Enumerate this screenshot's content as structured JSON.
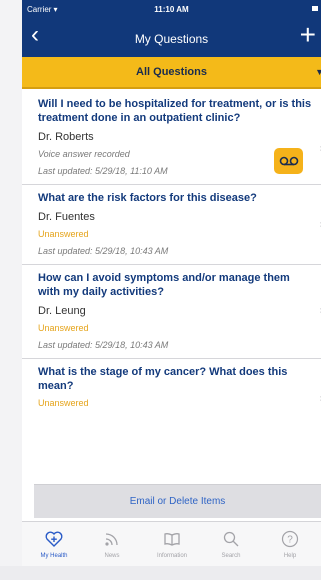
{
  "status_bar": {
    "carrier": "Carrier",
    "time": "11:10 AM"
  },
  "nav": {
    "title": "My Questions",
    "back_icon": "chevron-left-icon",
    "add_icon": "plus-icon"
  },
  "filter": {
    "label": "All Questions"
  },
  "questions": [
    {
      "text": "Will I need to be hospitalized for treatment, or is this treatment done in an outpatient clinic?",
      "doctor": "Dr. Roberts",
      "status": "Voice answer recorded",
      "updated": "Last updated: 5/29/18, 11:10 AM"
    },
    {
      "text": "What are the risk factors for this disease?",
      "doctor": "Dr. Fuentes",
      "status": "Unanswered",
      "updated": "Last updated: 5/29/18, 10:43 AM"
    },
    {
      "text": "How can I avoid symptoms and/or manage them with my daily activities?",
      "doctor": "Dr. Leung",
      "status": "Unanswered",
      "updated": "Last updated: 5/29/18, 10:43 AM"
    },
    {
      "text": "What is the stage of my cancer? What does this mean?",
      "status": "Unanswered"
    }
  ],
  "action_bar": {
    "label": "Email or Delete Items"
  },
  "tabs": [
    {
      "label": "My Health",
      "icon": "heart-plus-icon",
      "active": true
    },
    {
      "label": "News",
      "icon": "rss-icon"
    },
    {
      "label": "Information",
      "icon": "book-icon"
    },
    {
      "label": "Search",
      "icon": "search-icon"
    },
    {
      "label": "Help",
      "icon": "help-icon"
    }
  ],
  "colors": {
    "nav": "#11387a",
    "accent": "#f4ba19",
    "question_text": "#133a7c",
    "unanswered": "#e5a41b",
    "tab_active": "#2a5bc7"
  }
}
